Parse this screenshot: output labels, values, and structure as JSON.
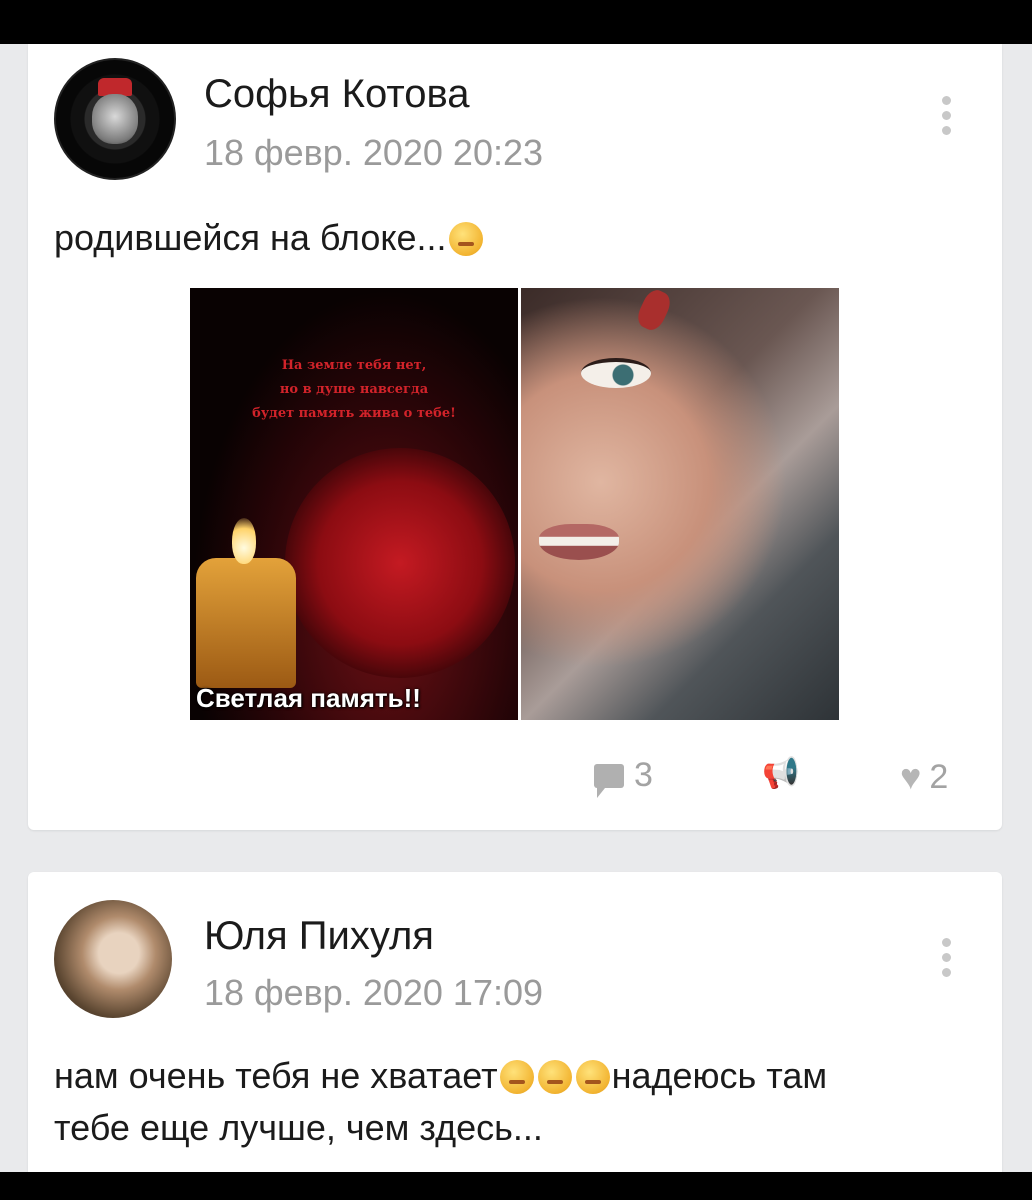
{
  "posts": [
    {
      "author": "Софья Котова",
      "date": "18 февр. 2020 20:23",
      "text_before_emoji": "родившейся на блоке...",
      "image": {
        "poem_lines": [
          "На земле тебя нет,",
          "но в душе навсегда",
          "будет память жива о тебе!"
        ],
        "caption": "Светлая память!!"
      },
      "comments_count": "3",
      "likes_count": "2"
    },
    {
      "author": "Юля Пихуля",
      "date": "18 февр. 2020 17:09",
      "text_part1": "нам очень тебя не хватает",
      "text_part2": "надеюсь там",
      "text_line2": "тебе еще лучше, чем здесь..."
    }
  ],
  "icons": {
    "menu": "more-vertical-icon",
    "comment": "comment-icon",
    "share": "share-icon",
    "like": "heart-icon"
  },
  "colors": {
    "background": "#e9eaec",
    "card": "#ffffff",
    "meta_text": "#9a9a9a"
  }
}
